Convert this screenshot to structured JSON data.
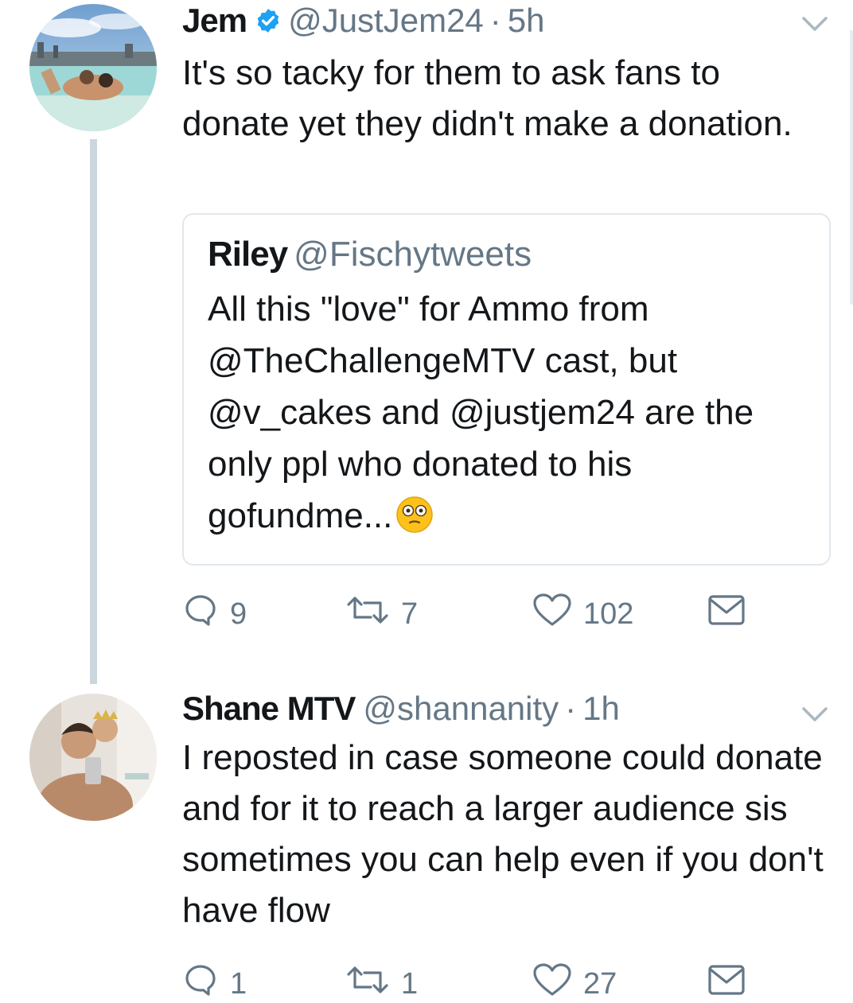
{
  "tweets": [
    {
      "display_name": "Jem",
      "verified": true,
      "handle": "@JustJem24",
      "separator": "·",
      "time": "5h",
      "text": "It's so tacky for them to ask fans to donate yet they didn't make a donation.",
      "quoted": {
        "display_name": "Riley",
        "handle": "@Fischytweets",
        "text": "All this \"love\" for Ammo from @TheChallengeMTV cast, but @v_cakes and @justjem24 are the only ppl who donated to his gofundme...",
        "emoji": "flushed-face"
      },
      "replies": "9",
      "retweets": "7",
      "likes": "102"
    },
    {
      "display_name": "Shane MTV",
      "handle": "@shannanity",
      "separator": "·",
      "time": "1h",
      "text": "I reposted in case someone could donate and for it to reach a larger audience sis sometimes you can help even if you don't have flow",
      "replies": "1",
      "retweets": "1",
      "likes": "27"
    }
  ],
  "colors": {
    "text": "#14171a",
    "secondary": "#657786",
    "verified": "#1da1f2",
    "thread_line": "#ccd6dd",
    "quote_border": "#e1e8ed"
  },
  "icons": [
    "verified-badge-icon",
    "chevron-down-icon",
    "reply-icon",
    "retweet-icon",
    "like-heart-icon",
    "direct-message-icon"
  ]
}
